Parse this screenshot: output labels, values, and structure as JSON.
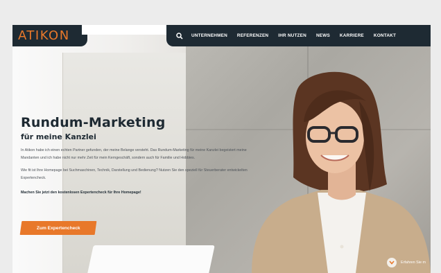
{
  "header": {
    "logo_text": "ATIKON",
    "nav": [
      {
        "label": "UNTERNEHMEN"
      },
      {
        "label": "REFERENZEN"
      },
      {
        "label": "IHR NUTZEN"
      },
      {
        "label": "NEWS"
      },
      {
        "label": "KARRIERE"
      },
      {
        "label": "KONTAKT"
      }
    ],
    "search_icon": "search-icon"
  },
  "hero": {
    "title": "Rundum-Marketing",
    "subtitle": "für meine Kanzlei",
    "para1": "In Atikon habe ich einen echten Partner gefunden, der meine Belange versteht. Das Rundum-Marketing für meine Kanzlei begeistert meine Mandanten und ich habe nicht nur mehr Zeit für mein Kerngeschäft, sondern auch für Familie und Hobbies.",
    "para2": "Wie fit ist Ihre Homepage bei Suchmaschinen, Technik, Darstellung und Bedienung? Nutzen Sie den speziell für Steuerberater entwickelten Expertencheck.",
    "para3": "Machen Sie jetzt den kostenlosen Expertencheck für Ihre Homepage!",
    "cta_label": "Zum Expertencheck"
  },
  "scroll_hint": {
    "label": "Erfahren Sie m",
    "icon": "chevron-down-icon"
  },
  "colors": {
    "accent": "#e8782a",
    "dark": "#1e2a33"
  }
}
